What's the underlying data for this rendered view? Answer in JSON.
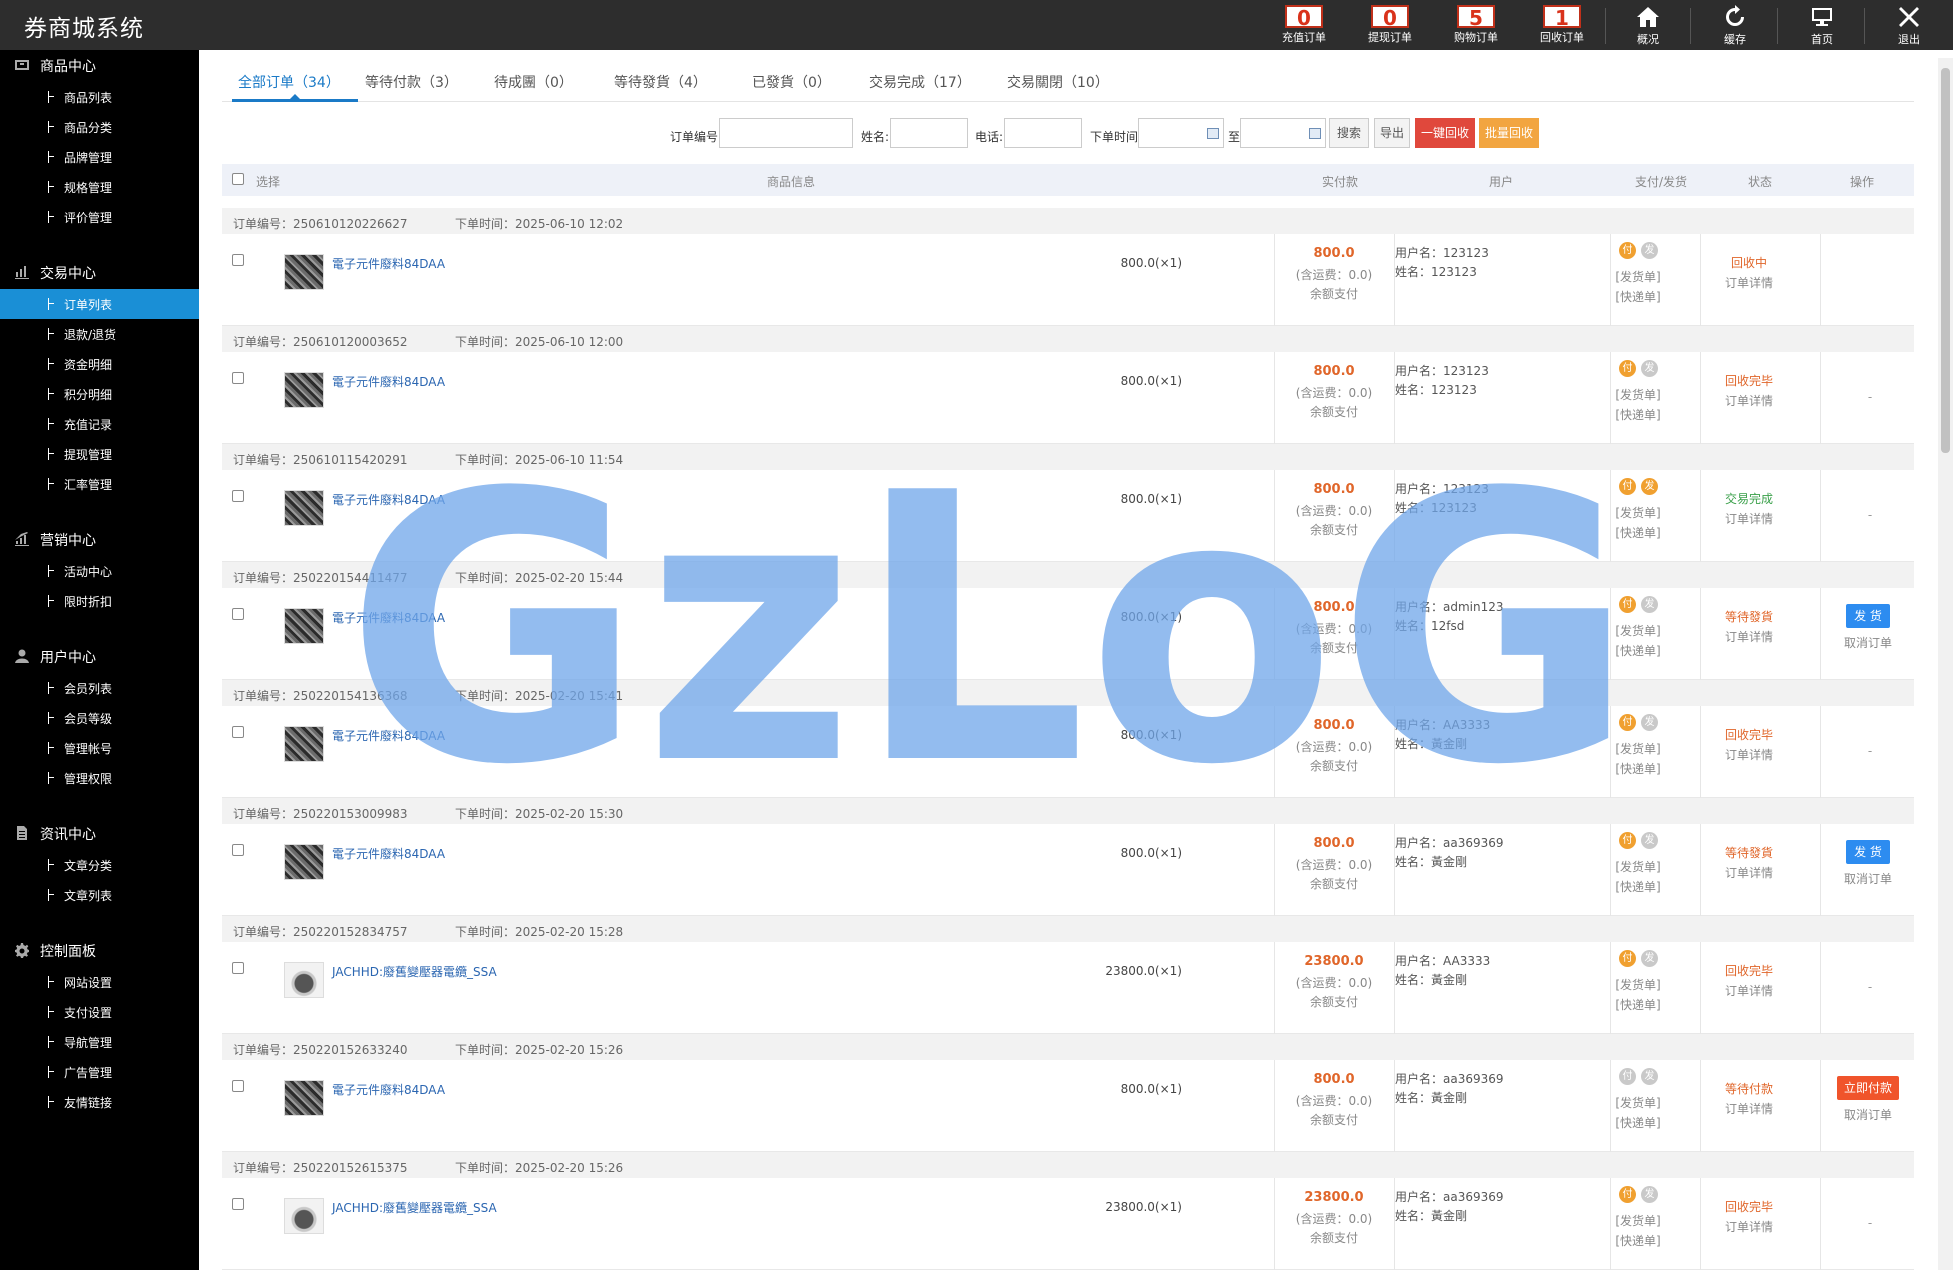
{
  "app_title": "券商城系统",
  "topbar": {
    "counters": [
      {
        "count": "0",
        "label": "充值订单"
      },
      {
        "count": "0",
        "label": "提现订单"
      },
      {
        "count": "5",
        "label": "购物订单"
      },
      {
        "count": "1",
        "label": "回收订单"
      }
    ],
    "actions": [
      {
        "icon": "home-icon",
        "label": "概况"
      },
      {
        "icon": "refresh-icon",
        "label": "缓存"
      },
      {
        "icon": "monitor-icon",
        "label": "首页"
      },
      {
        "icon": "close-icon",
        "label": "退出"
      }
    ]
  },
  "sidebar": {
    "groups": [
      {
        "title": "商品中心",
        "icon": "box-icon",
        "items": [
          "商品列表",
          "商品分类",
          "品牌管理",
          "规格管理",
          "评价管理"
        ]
      },
      {
        "title": "交易中心",
        "icon": "bar-chart-icon",
        "items": [
          "订单列表",
          "退款/退货",
          "资金明细",
          "积分明细",
          "充值记录",
          "提现管理",
          "汇率管理"
        ]
      },
      {
        "title": "营销中心",
        "icon": "trend-icon",
        "items": [
          "活动中心",
          "限时折扣"
        ]
      },
      {
        "title": "用户中心",
        "icon": "user-icon",
        "items": [
          "会员列表",
          "会员等级",
          "管理帐号",
          "管理权限"
        ]
      },
      {
        "title": "资讯中心",
        "icon": "document-icon",
        "items": [
          "文章分类",
          "文章列表"
        ]
      },
      {
        "title": "控制面板",
        "icon": "gear-icon",
        "items": [
          "网站设置",
          "支付设置",
          "导航管理",
          "广告管理",
          "友情链接"
        ]
      }
    ],
    "active_item": "订单列表"
  },
  "tabs": [
    "全部订单（34）",
    "等待付款（3）",
    "待成團（0）",
    "等待發貨（4）",
    "已發貨（0）",
    "交易完成（17）",
    "交易關閉（10）"
  ],
  "filters": {
    "order_no_label": "订单编号:",
    "name_label": "姓名:",
    "phone_label": "电话:",
    "time_label": "下单时间:",
    "to_label": "至",
    "search_btn": "搜索",
    "export_btn": "导出",
    "recycle_btn": "一键回收",
    "batch_btn": "批量回收"
  },
  "table_headers": {
    "select": "选择",
    "product": "商品信息",
    "paid": "实付款",
    "user": "用户",
    "pay_ship": "支付/发货",
    "status": "状态",
    "ops": "操作"
  },
  "order_labels": {
    "order_no": "订单编号：",
    "order_time": "下单时间：",
    "user_prefix": "用户名：",
    "name_prefix": "姓名：",
    "pay_dot": "付",
    "ship_dot": "发",
    "ship_link": "[发货单]",
    "express_link": "[快递单]",
    "detail": "订单详情",
    "ship_btn": "发 货",
    "pay_btn": "立即付款",
    "cancel": "取消订单",
    "dash": "-"
  },
  "orders": [
    {
      "no": "250610120226627",
      "time": "2025-06-10 12:02",
      "product": "電子元件廢料84DAA",
      "img": "dark",
      "qty": "800.0(×1)",
      "price": "800.0",
      "fee": "(含运费：0.0)",
      "paytype": "余额支付",
      "user": "123123",
      "name": "123123",
      "paid": true,
      "shipped": false,
      "status": "回收中",
      "status_color": "#e0662a",
      "op": "none"
    },
    {
      "no": "250610120003652",
      "time": "2025-06-10 12:00",
      "product": "電子元件廢料84DAA",
      "img": "dark",
      "qty": "800.0(×1)",
      "price": "800.0",
      "fee": "(含运费：0.0)",
      "paytype": "余额支付",
      "user": "123123",
      "name": "123123",
      "paid": true,
      "shipped": false,
      "status": "回收完毕",
      "status_color": "#e0662a",
      "op": "dash"
    },
    {
      "no": "250610115420291",
      "time": "2025-06-10 11:54",
      "product": "電子元件廢料84DAA",
      "img": "dark",
      "qty": "800.0(×1)",
      "price": "800.0",
      "fee": "(含运费：0.0)",
      "paytype": "余额支付",
      "user": "123123",
      "name": "123123",
      "paid": true,
      "shipped": true,
      "status": "交易完成",
      "status_color": "#3aa04a",
      "op": "dash"
    },
    {
      "no": "250220154411477",
      "time": "2025-02-20 15:44",
      "product": "電子元件廢料84DAA",
      "img": "dark",
      "qty": "800.0(×1)",
      "price": "800.0",
      "fee": "(含运费：0.0)",
      "paytype": "余额支付",
      "user": "admin123",
      "name": "12fsd",
      "paid": true,
      "shipped": false,
      "status": "等待發貨",
      "status_color": "#e0662a",
      "op": "ship"
    },
    {
      "no": "250220154136368",
      "time": "2025-02-20 15:41",
      "product": "電子元件廢料84DAA",
      "img": "dark",
      "qty": "800.0(×1)",
      "price": "800.0",
      "fee": "(含运费：0.0)",
      "paytype": "余额支付",
      "user": "AA3333",
      "name": "黃金剛",
      "paid": true,
      "shipped": false,
      "status": "回收完毕",
      "status_color": "#e0662a",
      "op": "dash"
    },
    {
      "no": "250220153009983",
      "time": "2025-02-20 15:30",
      "product": "電子元件廢料84DAA",
      "img": "dark",
      "qty": "800.0(×1)",
      "price": "800.0",
      "fee": "(含运费：0.0)",
      "paytype": "余额支付",
      "user": "aa369369",
      "name": "黃金剛",
      "paid": true,
      "shipped": false,
      "status": "等待發貨",
      "status_color": "#e0662a",
      "op": "ship"
    },
    {
      "no": "250220152834757",
      "time": "2025-02-20 15:28",
      "product": "JACHHD:廢舊變壓器電纜_SSA",
      "img": "bag",
      "qty": "23800.0(×1)",
      "price": "23800.0",
      "fee": "(含运费：0.0)",
      "paytype": "余额支付",
      "user": "AA3333",
      "name": "黃金剛",
      "paid": true,
      "shipped": false,
      "status": "回收完毕",
      "status_color": "#e0662a",
      "op": "dash"
    },
    {
      "no": "250220152633240",
      "time": "2025-02-20 15:26",
      "product": "電子元件廢料84DAA",
      "img": "dark",
      "qty": "800.0(×1)",
      "price": "800.0",
      "fee": "(含运费：0.0)",
      "paytype": "余额支付",
      "user": "aa369369",
      "name": "黃金剛",
      "paid": false,
      "shipped": false,
      "status": "等待付款",
      "status_color": "#e0662a",
      "op": "pay"
    },
    {
      "no": "250220152615375",
      "time": "2025-02-20 15:26",
      "product": "JACHHD:廢舊變壓器電纜_SSA",
      "img": "bag",
      "qty": "23800.0(×1)",
      "price": "23800.0",
      "fee": "(含运费：0.0)",
      "paytype": "余额支付",
      "user": "aa369369",
      "name": "黃金剛",
      "paid": true,
      "shipped": false,
      "status": "回收完毕",
      "status_color": "#e0662a",
      "op": "dash"
    }
  ],
  "watermark": "GzLoG",
  "colors": {
    "accent": "#1a7ac7",
    "active_nav": "#1a8fd6",
    "price": "#e0662a",
    "watermark": "#6fa6ea"
  }
}
